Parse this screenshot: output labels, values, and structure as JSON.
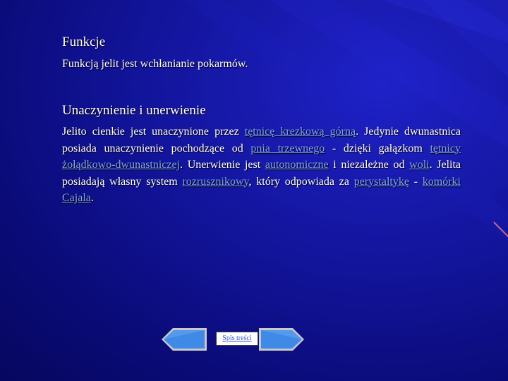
{
  "section1": {
    "heading": "Funkcje",
    "text": "Funkcją jelit jest wchłanianie pokarmów."
  },
  "section2": {
    "heading": "Unaczynienie i unerwienie",
    "t1": "Jelito cienkie jest unaczynione przez ",
    "l1": "tętnicę krezkową górną",
    "t2": ". Jedynie dwunastnica posiada unaczynienie pochodzące od ",
    "l2": "pnia trzewnego",
    "t3": " - dzięki gałązkom ",
    "l3": "tętnicy żołądkowo-dwunastniczej",
    "t4": ". Unerwienie jest ",
    "l4": "autonomiczne",
    "t5": " i niezależne od ",
    "l5": "woli",
    "t6": ". Jelita posiadają własny system ",
    "l6": "rozrusznikowy",
    "t7": ", który odpowiada za ",
    "l7": "perystaltykę",
    "t8": " - ",
    "l8": "komórki Cajala",
    "t9": "."
  },
  "nav": {
    "toc_label": "Spis treści",
    "prev_icon": "left-arrow-icon",
    "next_icon": "right-arrow-icon"
  },
  "colors": {
    "background": "#12149a",
    "link": "#7fa3e6",
    "arrow_fill": "#3f8ae6"
  }
}
